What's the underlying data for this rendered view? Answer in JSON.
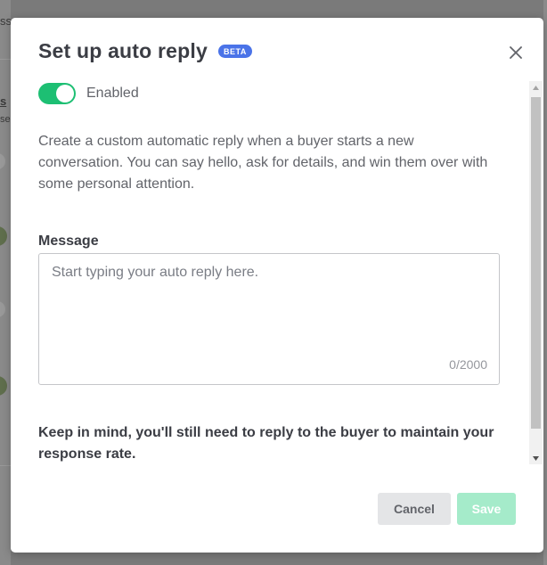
{
  "backdrop": {
    "fragment_1": "ss",
    "fragment_2": "s",
    "fragment_3": "se"
  },
  "modal": {
    "title": "Set up auto reply",
    "badge": "BETA",
    "close_icon": "close-icon"
  },
  "toggle": {
    "label": "Enabled",
    "checked": true,
    "color": "#1dbf73"
  },
  "description": "Create a custom automatic reply when a buyer starts a new conversation. You can say hello, ask for details, and win them over with some personal attention.",
  "message": {
    "label": "Message",
    "placeholder": "Start typing your auto reply here.",
    "value": "",
    "char_count": "0/2000"
  },
  "note": "Keep in mind, you'll still need to reply to the buyer to maintain your response rate.",
  "footer": {
    "cancel_label": "Cancel",
    "save_label": "Save",
    "save_enabled": false,
    "save_color": "#a5ebca"
  },
  "colors": {
    "accent": "#1dbf73",
    "badge": "#4a73e8"
  }
}
